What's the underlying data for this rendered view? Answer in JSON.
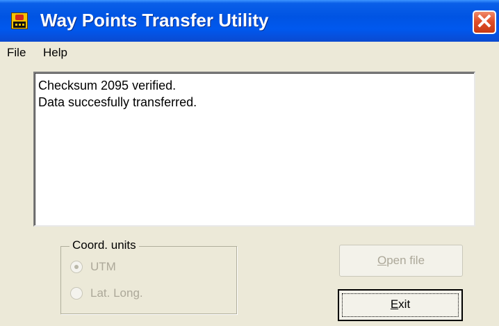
{
  "window": {
    "title": "Way Points Transfer Utility",
    "close_glyph": "✕"
  },
  "menu": {
    "items": [
      {
        "label": "File"
      },
      {
        "label": "Help"
      }
    ]
  },
  "log": {
    "lines": [
      "Checksum 2095 verified.",
      "Data succesfully transferred."
    ]
  },
  "coord_units": {
    "label": "Coord. units",
    "options": [
      {
        "label": "UTM",
        "selected": true,
        "enabled": false
      },
      {
        "label": "Lat. Long.",
        "selected": false,
        "enabled": false
      }
    ]
  },
  "buttons": {
    "open_file": {
      "label_first": "O",
      "label_rest": "pen file",
      "enabled": false
    },
    "exit": {
      "label_first": "E",
      "label_rest": "xit",
      "enabled": true
    }
  },
  "colors": {
    "titlebar": "#0054e3",
    "face": "#ece9d8",
    "disabled_text": "#aca899",
    "close": "#e0502a"
  }
}
